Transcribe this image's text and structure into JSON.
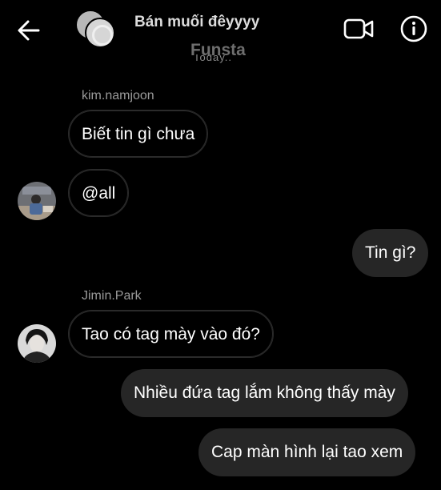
{
  "header": {
    "chat_name": "Bán muối đêyyyy",
    "subtitle": "Funsta",
    "date_label": "Today.."
  },
  "messages": [
    {
      "sender": "kim.namjoon",
      "text": "Biết tin gì chưa",
      "direction": "incoming"
    },
    {
      "text": "@all",
      "direction": "incoming"
    },
    {
      "text": "Tin gì?",
      "direction": "outgoing"
    },
    {
      "sender": "Jimin.Park",
      "text": "Tao có tag mày vào đó?",
      "direction": "incoming"
    },
    {
      "text": "Nhiều đứa tag lắm không thấy mày",
      "direction": "outgoing"
    },
    {
      "text": "Cap màn hình lại tao xem",
      "direction": "outgoing"
    }
  ],
  "icons": {
    "back": "arrow-left-icon",
    "video": "video-camera-icon",
    "info": "info-icon"
  },
  "colors": {
    "background": "#000000",
    "outgoing_bubble": "#262626",
    "incoming_bubble_border": "#2b2b2b",
    "muted_text": "#9a9a9a"
  }
}
